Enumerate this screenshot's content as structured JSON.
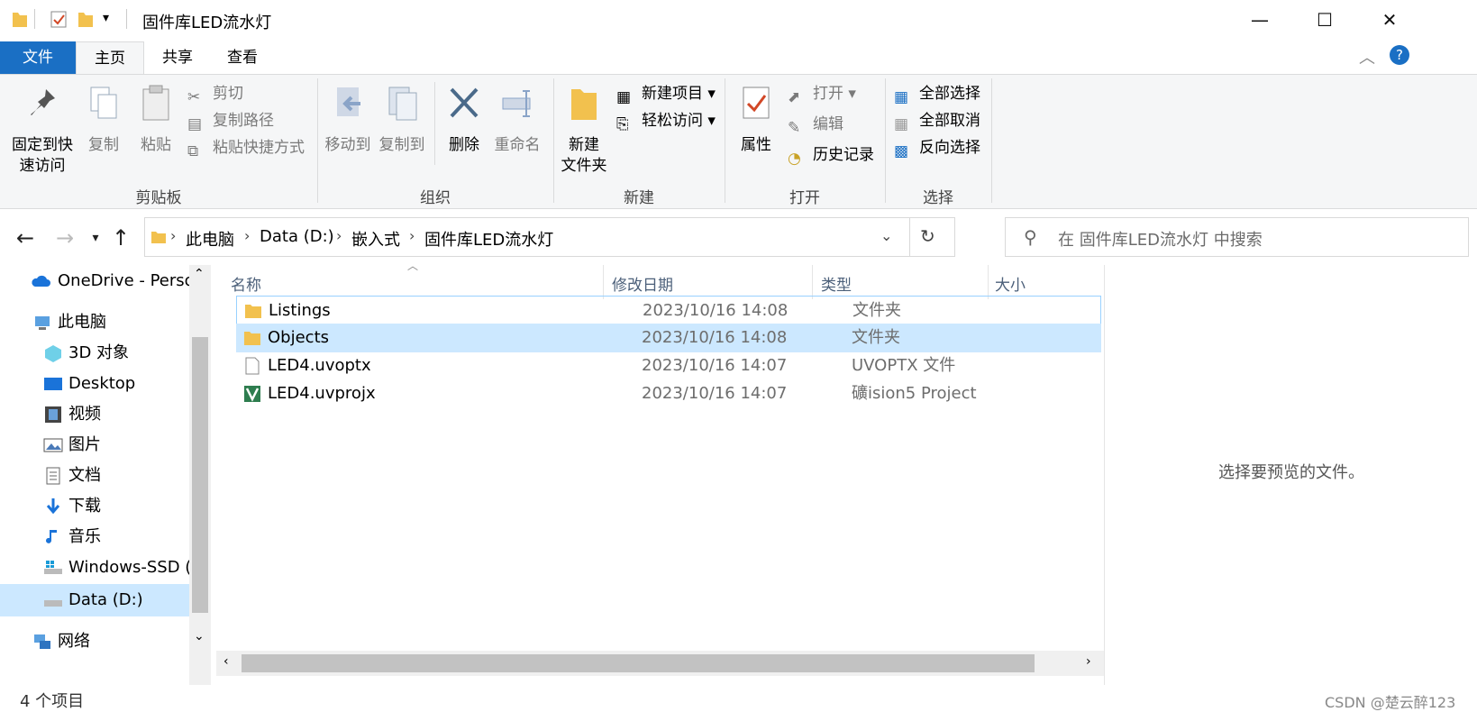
{
  "window": {
    "title": "固件库LED流水灯",
    "minimize_icon": "—",
    "maximize_icon": "☐",
    "close_icon": "✕"
  },
  "tabs": [
    {
      "label": "文件"
    },
    {
      "label": "主页"
    },
    {
      "label": "共享"
    },
    {
      "label": "查看"
    }
  ],
  "ribbon": {
    "clipboard": {
      "pin_line1": "固定到快",
      "pin_line2": "速访问",
      "copy": "复制",
      "paste": "粘贴",
      "cut": "剪切",
      "copy_path": "复制路径",
      "paste_shortcut": "粘贴快捷方式",
      "label": "剪贴板"
    },
    "organize": {
      "move_to": "移动到",
      "copy_to": "复制到",
      "delete": "删除",
      "rename": "重命名",
      "label": "组织"
    },
    "new": {
      "new_folder_line1": "新建",
      "new_folder_line2": "文件夹",
      "new_item": "新建项目",
      "easy_access": "轻松访问",
      "label": "新建"
    },
    "open": {
      "properties": "属性",
      "open": "打开",
      "edit": "编辑",
      "history": "历史记录",
      "label": "打开"
    },
    "select": {
      "select_all": "全部选择",
      "select_none": "全部取消",
      "invert": "反向选择",
      "label": "选择"
    }
  },
  "address": {
    "crumbs": [
      "此电脑",
      "Data (D:)",
      "嵌入式",
      "固件库LED流水灯"
    ],
    "search_placeholder": "在 固件库LED流水灯 中搜索"
  },
  "nav": [
    {
      "label": "OneDrive - Perso",
      "icon": "cloud-icon"
    },
    {
      "label": "此电脑",
      "icon": "computer-icon"
    },
    {
      "label": "3D 对象",
      "icon": "cube-icon"
    },
    {
      "label": "Desktop",
      "icon": "desktop-icon"
    },
    {
      "label": "视频",
      "icon": "video-icon"
    },
    {
      "label": "图片",
      "icon": "picture-icon"
    },
    {
      "label": "文档",
      "icon": "document-icon"
    },
    {
      "label": "下载",
      "icon": "download-icon"
    },
    {
      "label": "音乐",
      "icon": "music-icon"
    },
    {
      "label": "Windows-SSD (",
      "icon": "drive-icon"
    },
    {
      "label": "Data (D:)",
      "icon": "drive-icon"
    },
    {
      "label": "网络",
      "icon": "network-icon"
    }
  ],
  "columns": [
    "名称",
    "修改日期",
    "类型",
    "大小"
  ],
  "files": [
    {
      "name": "Listings",
      "date": "2023/10/16 14:08",
      "type": "文件夹",
      "icon": "folder-icon"
    },
    {
      "name": "Objects",
      "date": "2023/10/16 14:08",
      "type": "文件夹",
      "icon": "folder-icon"
    },
    {
      "name": "LED4.uvoptx",
      "date": "2023/10/16 14:07",
      "type": "UVOPTX 文件",
      "icon": "file-icon"
    },
    {
      "name": "LED4.uvprojx",
      "date": "2023/10/16 14:07",
      "type": "礦ision5 Project",
      "icon": "keil-project-icon"
    }
  ],
  "preview": {
    "message": "选择要预览的文件。"
  },
  "status": {
    "count": "4 个项目",
    "watermark": "CSDN @楚云醉123"
  },
  "colors": {
    "accent": "#1a6fc4",
    "selection": "#cce8ff",
    "folder": "#f2c14e"
  }
}
